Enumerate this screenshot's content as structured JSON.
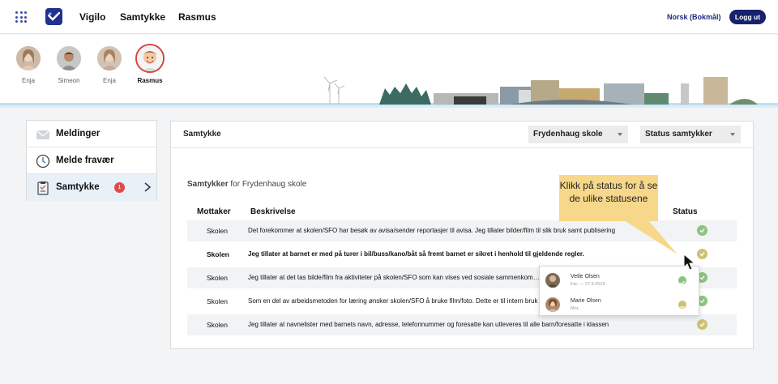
{
  "topbar": {
    "brand": "Vigilo",
    "nav_samtykke": "Samtykke",
    "nav_child": "Rasmus",
    "language": "Norsk (Bokmål)",
    "logout_label": "Logg ut"
  },
  "children": [
    {
      "name": "Enja"
    },
    {
      "name": "Simeon"
    },
    {
      "name": "Enja"
    },
    {
      "name": "Rasmus"
    }
  ],
  "sidebar": {
    "items": [
      {
        "label": "Meldinger"
      },
      {
        "label": "Melde fravær"
      },
      {
        "label": "Samtykke",
        "badge": "1"
      }
    ]
  },
  "main": {
    "title": "Samtykke",
    "school_select": "Frydenhaug skole",
    "status_select": "Status samtykker",
    "subtitle_bold": "Samtykker",
    "subtitle_rest": " for Frydenhaug skole",
    "columns": {
      "recipient": "Mottaker",
      "description": "Beskrivelse",
      "status": "Status"
    },
    "rows": [
      {
        "recipient": "Skolen",
        "description": "Det forekommer at skolen/SFO har besøk av avisa/sender reportasjer til avisa. Jeg tillater bilder/film til slik bruk samt publisering",
        "status": "ok"
      },
      {
        "recipient": "Skolen",
        "description": "Jeg tillater at barnet er med på turer i bil/buss/kano/båt så fremt barnet er sikret i henhold til gjeldende regler.",
        "status": "pending"
      },
      {
        "recipient": "Skolen",
        "description": "Jeg tillater at det tas bilde/film fra aktiviteter på skolen/SFO som kan vises ved sosiale sammenkomster",
        "status": "ok"
      },
      {
        "recipient": "Skolen",
        "description": "Som en del av arbeidsmetoden for læring ønsker skolen/SFO å bruke film/foto. Dette er til intern bruk",
        "status": "ok"
      },
      {
        "recipient": "Skolen",
        "description": "Jeg tillater at navnelister med barnets navn, adresse, telefonnummer og foresatte kan utleveres til alle barn/foresatte i klassen",
        "status": "pending"
      }
    ]
  },
  "popup": {
    "entries": [
      {
        "name": "Vetle Olsen",
        "meta": "Far,   —   27.9.2019",
        "status": "ok"
      },
      {
        "name": "Marie Olsen",
        "meta": "Mor,",
        "status": "pending"
      }
    ]
  },
  "callout": {
    "text": "Klikk på status for å se de ulike statusene"
  },
  "colors": {
    "brand": "#17226d",
    "ok": "#8cc37e",
    "pending": "#cfc173",
    "callout": "#f7d88a",
    "badge": "#e0494a"
  }
}
